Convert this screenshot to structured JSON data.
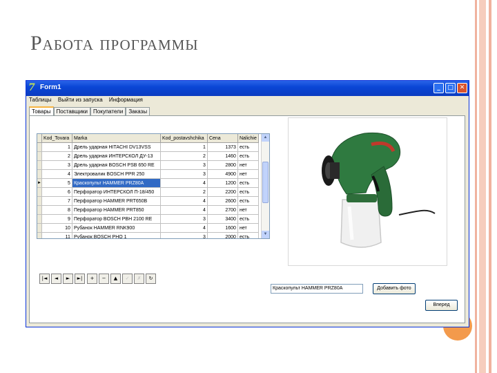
{
  "slide": {
    "title": "Работа программы"
  },
  "window": {
    "title": "Form1",
    "buttons": [
      "_",
      "□",
      "✕"
    ]
  },
  "menu": [
    "Таблицы",
    "Выйти из запуска",
    "Информация"
  ],
  "tabs": [
    "Товары",
    "Поставщики",
    "Покупатели",
    "Заказы"
  ],
  "grid": {
    "columns": [
      "Kod_Tovara",
      "Marka",
      "Kod_postavshchika",
      "Cena",
      "Nalichie"
    ],
    "rows": [
      [
        "1",
        "Дрель ударная HITACHI DV13VSS",
        "1",
        "1373",
        "есть"
      ],
      [
        "2",
        "Дрель ударная ИНТЕРСКОЛ ДУ-13",
        "2",
        "1460",
        "есть"
      ],
      [
        "3",
        "Дрель ударная BOSCH PSB 650 RE",
        "3",
        "2800",
        "нет"
      ],
      [
        "4",
        "Электровалик BOSCH PPR 250",
        "3",
        "4900",
        "нет"
      ],
      [
        "5",
        "Краскопульт HAMMER PRZ80A",
        "4",
        "1200",
        "есть"
      ],
      [
        "6",
        "Перфоратор ИНТЕРСКОЛ П-18/450",
        "2",
        "2200",
        "есть"
      ],
      [
        "7",
        "Перфоратор HAMMER PRT650B",
        "4",
        "2600",
        "есть"
      ],
      [
        "8",
        "Перфоратор HAMMER PRT850",
        "4",
        "2700",
        "нет"
      ],
      [
        "9",
        "Перфоратор BOSCH PBH 2100 RE",
        "3",
        "3400",
        "есть"
      ],
      [
        "10",
        "Рубанок HAMMER RNK900",
        "4",
        "1600",
        "нет"
      ],
      [
        "11",
        "Рубанок BOSCH PHO 1",
        "3",
        "2000",
        "есть"
      ]
    ],
    "selected_index": 4
  },
  "navigator": {
    "buttons": [
      {
        "icon": "first-icon",
        "glyph": "|◄"
      },
      {
        "icon": "prior-icon",
        "glyph": "◄"
      },
      {
        "icon": "next-icon",
        "glyph": "►"
      },
      {
        "icon": "last-icon",
        "glyph": "►|"
      },
      {
        "icon": "insert-icon",
        "glyph": "+"
      },
      {
        "icon": "delete-icon",
        "glyph": "−"
      },
      {
        "icon": "edit-icon",
        "glyph": "▲"
      },
      {
        "icon": "post-icon",
        "glyph": "✓"
      },
      {
        "icon": "cancel-icon",
        "glyph": "✗"
      },
      {
        "icon": "refresh-icon",
        "glyph": "↻"
      }
    ]
  },
  "product_field": "Краскопульт HAMMER PRZ80A",
  "add_photo_label": "Добавить фото",
  "next_label": "Вперед",
  "colors": {
    "accent_circle": "#f39a4c",
    "selection": "#316ac5",
    "titlebar": "#0a46d6"
  }
}
